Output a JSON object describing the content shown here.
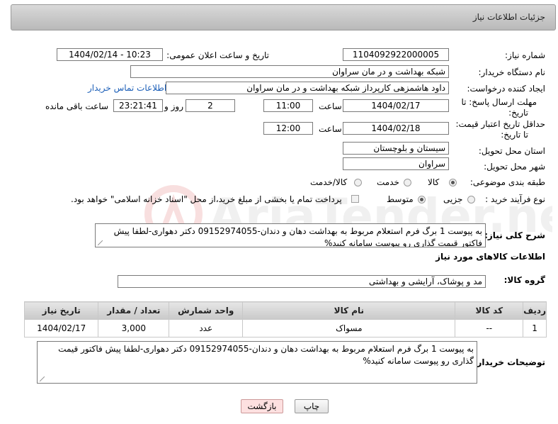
{
  "panel": {
    "title": "جزئیات اطلاعات نیاز"
  },
  "fields": {
    "need_number_label": "شماره نیاز:",
    "need_number": "1104092922000005",
    "announce_label": "تاریخ و ساعت اعلان عمومی:",
    "announce_value": "1404/02/14 - 10:23",
    "buyer_label": "نام دستگاه خریدار:",
    "buyer_value": "شبکه بهداشت و در مان سراوان",
    "creator_label": "ایجاد کننده درخواست:",
    "creator_value": "داود هاشمزهی  کارپرداز شبکه بهداشت و در مان سراوان",
    "contact_link": "اطلاعات تماس خریدار",
    "deadline_label_1": "مهلت ارسال پاسخ: تا",
    "deadline_label_2": "تاریخ:",
    "deadline_date": "1404/02/17",
    "time_label": "ساعت",
    "deadline_time": "11:00",
    "days_value": "2",
    "days_label": "روز و",
    "remaining_value": "23:21:41",
    "remaining_label": "ساعت باقی مانده",
    "validity_label_1": "حداقل تاریخ اعتبار قیمت:",
    "validity_label_2": "تا تاریخ:",
    "validity_date": "1404/02/18",
    "validity_time_label": "ساعت",
    "validity_time": "12:00",
    "province_label": "استان محل تحویل:",
    "province_value": "سیستان و بلوچستان",
    "city_label": "شهر محل تحویل:",
    "city_value": "سراوان",
    "category_label": "طبقه بندی موضوعی:",
    "category_options": [
      "کالا",
      "خدمت",
      "کالا/خدمت"
    ],
    "category_selected": "کالا",
    "process_label": "نوع فرآیند خرید :",
    "process_options": [
      "جزیی",
      "متوسط"
    ],
    "process_selected": "متوسط",
    "payment_note": "پرداخت تمام یا بخشی از مبلغ خرید،از محل \"اسناد خزانه اسلامی\" خواهد بود.",
    "description_label": "شرح کلی نیاز:",
    "description_value": "به پیوست 1 برگ فرم استعلام مربوط به بهداشت دهان و دندان-09152974055 دکتر دهواری-لطفا پیش فاکتور قیمت گذاری رو پیوست سامانه کنید%"
  },
  "items_section": {
    "title": "اطلاعات کالاهای مورد نیاز",
    "group_label": "گروه کالا:",
    "group_value": "مد و پوشاک، آرایشی و بهداشتی",
    "columns": [
      "ردیف",
      "کد کالا",
      "نام کالا",
      "واحد شمارش",
      "تعداد / مقدار",
      "تاریخ نیاز"
    ],
    "rows": [
      [
        "1",
        "--",
        "مسواک",
        "عدد",
        "3,000",
        "1404/02/17"
      ]
    ],
    "buyer_notes_label": "توضیحات خریدار:",
    "buyer_notes_value": "به پیوست 1 برگ فرم استعلام مربوط به بهداشت دهان و دندان-09152974055 دکتر دهواری-لطفا پیش فاکتور قیمت گذاری رو پیوست سامانه کنید%"
  },
  "buttons": {
    "print": "چاپ",
    "back": "بازگشت"
  },
  "watermark": {
    "text": "AriaTender.neT"
  },
  "colors": {
    "link": "#1c5fb8",
    "panel": "#c8c8c8",
    "back_button": "#fde0e0"
  }
}
